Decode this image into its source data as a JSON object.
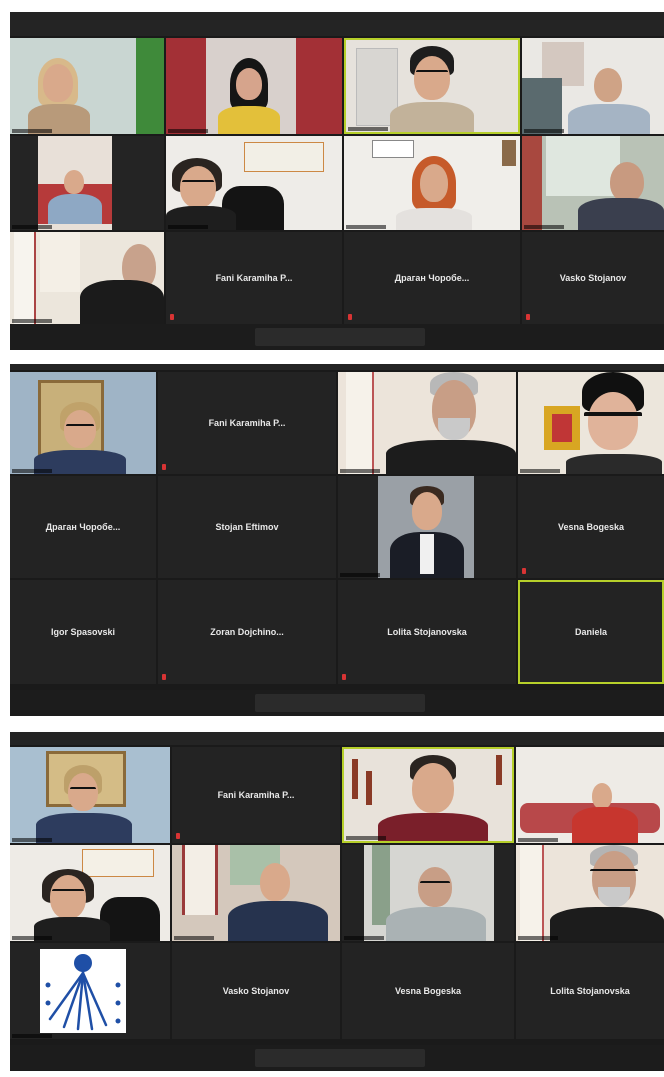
{
  "screenshots": [
    {
      "id": "meeting-1",
      "names": [
        "Fani Karamiha P...",
        "Драган Чоробе...",
        "Vasko Stojanov"
      ]
    },
    {
      "id": "meeting-2",
      "names": [
        "Fani Karamiha P...",
        "Драган Чоробе...",
        "Stojan Eftimov",
        "Vesna Bogeska",
        "Igor Spasovski",
        "Zoran Dojchino...",
        "Lolita Stojanovska",
        "Daniela"
      ]
    },
    {
      "id": "meeting-3",
      "names": [
        "Fani Karamiha P...",
        "Vasko Stojanov",
        "Vesna Bogeska",
        "Lolita Stojanovska"
      ]
    }
  ],
  "colors": {
    "active_speaker_border": "#b6cf2a",
    "tile_background": "#232323",
    "mic_muted": "#d83434"
  }
}
